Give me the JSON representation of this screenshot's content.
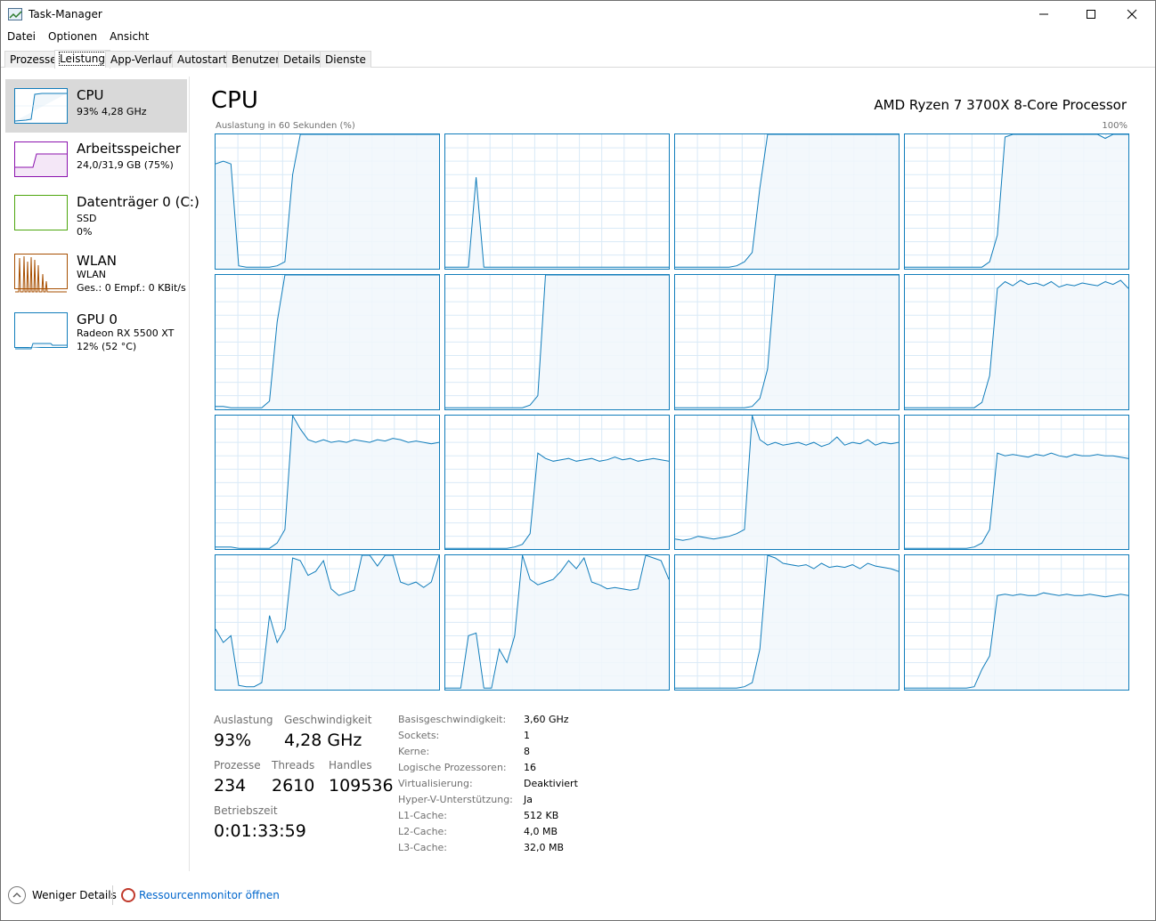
{
  "window": {
    "title": "Task-Manager"
  },
  "menu": [
    {
      "label": "Datei"
    },
    {
      "label": "Optionen"
    },
    {
      "label": "Ansicht"
    }
  ],
  "tabs": [
    {
      "label": "Prozesse"
    },
    {
      "label": "Leistung",
      "active": true
    },
    {
      "label": "App-Verlauf"
    },
    {
      "label": "Autostart"
    },
    {
      "label": "Benutzer"
    },
    {
      "label": "Details"
    },
    {
      "label": "Dienste"
    }
  ],
  "sidebar": {
    "items": [
      {
        "title": "CPU",
        "line1": "93%  4,28 GHz",
        "line2": "",
        "line3": "",
        "color": "#117dbb"
      },
      {
        "title": "Arbeitsspeicher",
        "line1": "24,0/31,9 GB (75%)",
        "line2": "",
        "line3": "",
        "color": "#8b12ae"
      },
      {
        "title": "Datenträger 0 (C:)",
        "line1": "SSD",
        "line2": "0%",
        "line3": "",
        "color": "#4da60c"
      },
      {
        "title": "WLAN",
        "line1": "WLAN",
        "line2": "Ges.: 0  Empf.: 0 KBit/s",
        "line3": "",
        "color": "#a74f01"
      },
      {
        "title": "GPU 0",
        "line1": "Radeon RX 5500 XT",
        "line2": "12%  (52 °C)",
        "line3": "",
        "color": "#117dbb"
      }
    ]
  },
  "main": {
    "title": "CPU",
    "processor": "AMD Ryzen 7 3700X 8-Core Processor",
    "graph_label": "Auslastung in 60 Sekunden (%)",
    "graph_max": "100%",
    "accent_color": "#117dbb",
    "fill_color": "#f1f7fb",
    "cores": [
      [
        78,
        80,
        78,
        2,
        1,
        1,
        1,
        1,
        2,
        5,
        70,
        100,
        100,
        100,
        100,
        100,
        100,
        100,
        100,
        100,
        100,
        100,
        100,
        100,
        100,
        100,
        100,
        100,
        100,
        100
      ],
      [
        1,
        1,
        1,
        1,
        68,
        1,
        1,
        1,
        1,
        1,
        1,
        1,
        1,
        1,
        1,
        1,
        1,
        1,
        1,
        1,
        1,
        1,
        1,
        1,
        1,
        1,
        1,
        1,
        1,
        1
      ],
      [
        1,
        1,
        1,
        1,
        1,
        1,
        1,
        1,
        2,
        5,
        12,
        60,
        100,
        100,
        100,
        100,
        100,
        100,
        100,
        100,
        100,
        100,
        100,
        100,
        100,
        100,
        100,
        100,
        100,
        100
      ],
      [
        1,
        1,
        1,
        1,
        1,
        1,
        1,
        1,
        1,
        1,
        1,
        5,
        25,
        98,
        100,
        100,
        100,
        100,
        100,
        100,
        100,
        100,
        100,
        100,
        100,
        100,
        97,
        100,
        100,
        100
      ],
      [
        2,
        2,
        1,
        1,
        1,
        1,
        1,
        6,
        65,
        100,
        100,
        100,
        100,
        100,
        100,
        100,
        100,
        100,
        100,
        100,
        100,
        100,
        100,
        100,
        100,
        100,
        100,
        100,
        100,
        100
      ],
      [
        1,
        1,
        1,
        1,
        1,
        1,
        1,
        1,
        1,
        1,
        1,
        3,
        10,
        100,
        100,
        100,
        100,
        100,
        100,
        100,
        100,
        100,
        100,
        100,
        100,
        100,
        100,
        100,
        100,
        100
      ],
      [
        1,
        1,
        1,
        1,
        1,
        1,
        1,
        1,
        1,
        1,
        2,
        8,
        30,
        100,
        100,
        100,
        100,
        100,
        100,
        100,
        100,
        100,
        100,
        100,
        100,
        100,
        100,
        100,
        100,
        100
      ],
      [
        1,
        1,
        1,
        1,
        1,
        1,
        1,
        1,
        1,
        1,
        5,
        25,
        90,
        95,
        92,
        96,
        93,
        94,
        92,
        95,
        91,
        93,
        92,
        94,
        93,
        92,
        95,
        93,
        96,
        90
      ],
      [
        2,
        2,
        2,
        1,
        1,
        1,
        1,
        1,
        5,
        15,
        100,
        90,
        82,
        80,
        82,
        80,
        81,
        80,
        82,
        81,
        80,
        82,
        81,
        83,
        82,
        80,
        81,
        80,
        79,
        80
      ],
      [
        1,
        1,
        1,
        1,
        1,
        1,
        1,
        1,
        1,
        2,
        4,
        12,
        72,
        68,
        66,
        67,
        68,
        66,
        67,
        68,
        66,
        67,
        69,
        67,
        68,
        66,
        67,
        68,
        67,
        66
      ],
      [
        8,
        7,
        8,
        10,
        9,
        8,
        9,
        10,
        12,
        15,
        100,
        82,
        78,
        80,
        78,
        79,
        80,
        78,
        80,
        77,
        79,
        84,
        78,
        80,
        79,
        82,
        78,
        80,
        79,
        80
      ],
      [
        1,
        1,
        1,
        1,
        1,
        1,
        1,
        1,
        1,
        2,
        5,
        15,
        72,
        70,
        71,
        70,
        69,
        71,
        70,
        72,
        70,
        69,
        71,
        70,
        70,
        71,
        70,
        70,
        69,
        68
      ],
      [
        45,
        35,
        40,
        3,
        2,
        2,
        5,
        55,
        35,
        45,
        98,
        96,
        85,
        88,
        96,
        75,
        70,
        72,
        74,
        100,
        100,
        92,
        100,
        100,
        80,
        78,
        80,
        76,
        80,
        100
      ],
      [
        1,
        1,
        1,
        40,
        42,
        1,
        1,
        30,
        20,
        40,
        100,
        82,
        78,
        80,
        82,
        88,
        96,
        90,
        98,
        80,
        78,
        75,
        76,
        75,
        74,
        75,
        100,
        98,
        96,
        82
      ],
      [
        1,
        1,
        1,
        1,
        1,
        1,
        1,
        1,
        1,
        2,
        5,
        30,
        100,
        98,
        94,
        93,
        92,
        93,
        90,
        94,
        91,
        92,
        91,
        93,
        90,
        94,
        92,
        91,
        90,
        88
      ],
      [
        1,
        1,
        1,
        1,
        1,
        1,
        1,
        1,
        1,
        2,
        15,
        25,
        70,
        71,
        70,
        71,
        70,
        70,
        72,
        71,
        70,
        71,
        70,
        70,
        71,
        70,
        69,
        70,
        71,
        70
      ]
    ]
  },
  "stats": {
    "auslastung_label": "Auslastung",
    "auslastung": "93%",
    "geschw_label": "Geschwindigkeit",
    "geschw": "4,28 GHz",
    "prozesse_label": "Prozesse",
    "prozesse": "234",
    "threads_label": "Threads",
    "threads": "2610",
    "handles_label": "Handles",
    "handles": "109536",
    "betrieb_label": "Betriebszeit",
    "betrieb": "0:01:33:59"
  },
  "info": [
    {
      "key": "Basisgeschwindigkeit:",
      "value": "3,60 GHz"
    },
    {
      "key": "Sockets:",
      "value": "1"
    },
    {
      "key": "Kerne:",
      "value": "8"
    },
    {
      "key": "Logische Prozessoren:",
      "value": "16"
    },
    {
      "key": "Virtualisierung:",
      "value": "Deaktiviert"
    },
    {
      "key": "Hyper-V-Unterstützung:",
      "value": "Ja"
    },
    {
      "key": "L1-Cache:",
      "value": "512 KB"
    },
    {
      "key": "L2-Cache:",
      "value": "4,0 MB"
    },
    {
      "key": "L3-Cache:",
      "value": "32,0 MB"
    }
  ],
  "footer": {
    "less_details": "Weniger Details",
    "resmon": "Ressourcenmonitor öffnen"
  }
}
